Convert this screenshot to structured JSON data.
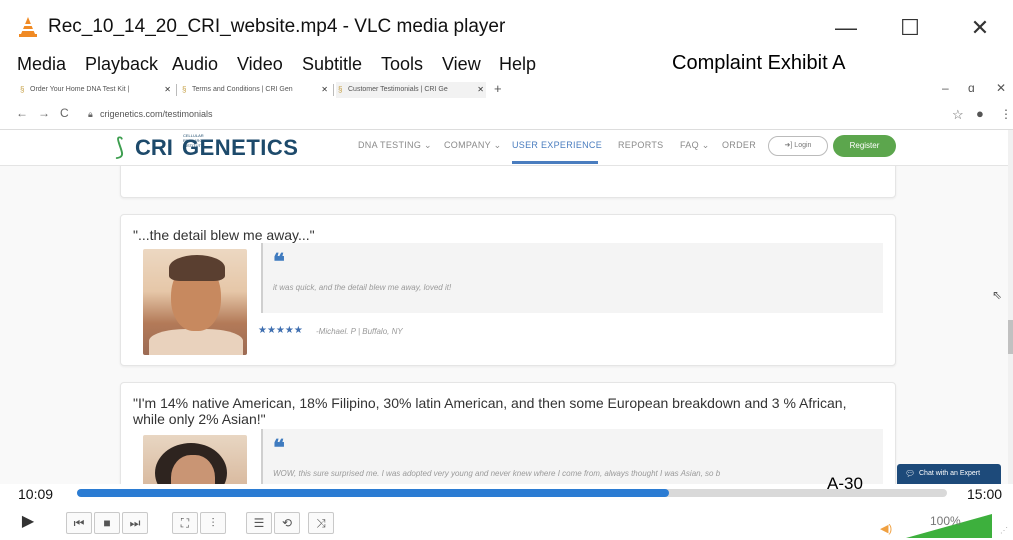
{
  "vlc": {
    "title": "Rec_10_14_20_CRI_website.mp4 - VLC media player",
    "menu": [
      "Media",
      "Playback",
      "Audio",
      "Video",
      "Subtitle",
      "Tools",
      "View",
      "Help"
    ],
    "window_controls": [
      "—",
      "☐",
      "✕"
    ],
    "time_current": "10:09",
    "time_total": "15:00",
    "progress": 0.68,
    "volume": "100%",
    "accent_color": "#2b7cd3"
  },
  "annotations": {
    "exhibit": "Complaint Exhibit A",
    "page_number": "A-30"
  },
  "browser": {
    "tabs": [
      "Order Your Home DNA Test Kit |",
      "Terms and Conditions | CRI Gen",
      "Customer Testimonials | CRI Ge"
    ],
    "new_tab": "+",
    "url": "crigenetics.com/testimonials"
  },
  "site": {
    "logo_small": "CELLULAR RESEARCH INSTITUTE",
    "logo_cri": "CRI",
    "logo_genetics": "GENETICS",
    "nav": [
      "DNA TESTING ⌄",
      "COMPANY ⌄",
      "USER EXPERIENCE",
      "REPORTS",
      "FAQ ⌄",
      "ORDER"
    ],
    "login": "➜] Login",
    "register": "Register",
    "brand_green": "#5ca64d",
    "brand_blue": "#1d4a6b"
  },
  "testimonials": [
    {
      "headline": "\"...the detail blew me away...\"",
      "quote": "it was quick, and the detail blew me away, loved it!",
      "stars": "★★★★★",
      "author": "-Michael. P | Buffalo, NY"
    },
    {
      "headline": "\"I'm 14% native American, 18% Filipino, 30% latin American, and then some European breakdown and 3 % African, while only 2% Asian!\"",
      "quote": "WOW, this sure surprised me. I was adopted very young and never knew where I come from, always thought I was Asian, so b"
    }
  ],
  "chat": {
    "label": "Chat with an Expert"
  }
}
